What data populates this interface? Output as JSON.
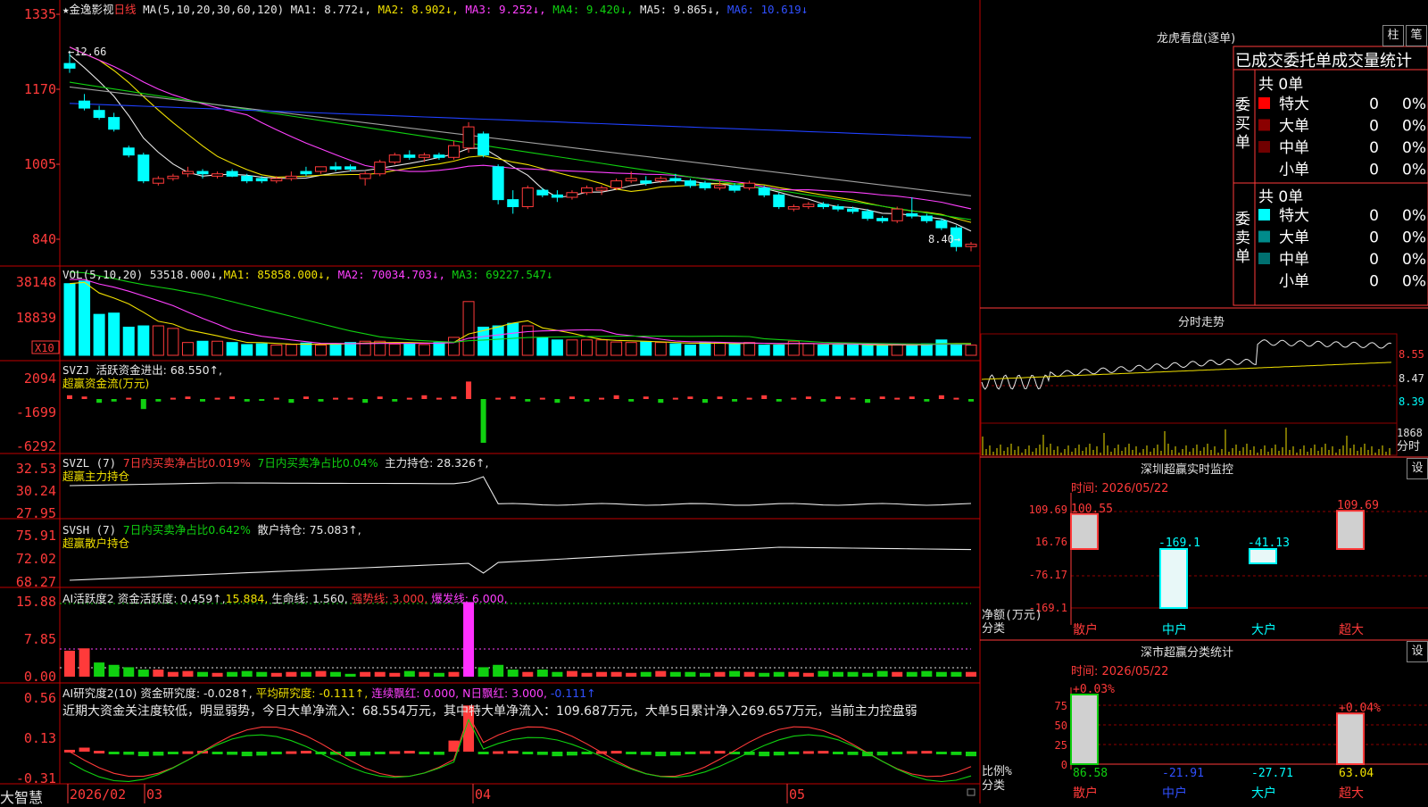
{
  "header": {
    "star": "★",
    "stock_name": "金逸影视",
    "period": "日线",
    "ma_label": "MA(5,10,20,30,60,120)",
    "ma1": "MA1: 8.772↓,",
    "ma2": "MA2: 8.902↓,",
    "ma3": "MA3: 9.252↓,",
    "ma4": "MA4: 9.420↓,",
    "ma5": "MA5: 9.865↓,",
    "ma6": "MA6: 10.619↓"
  },
  "price_axis": {
    "ticks": [
      "1335",
      "1170",
      "1005",
      "840"
    ],
    "high_mark": "12.66",
    "low_mark": "8.40"
  },
  "vol_panel": {
    "title": "VOL(5,10,20)",
    "vol": "53518.000↓,",
    "ma1": "MA1: 85858.000↓,",
    "ma2": "MA2: 70034.703↓,",
    "ma3": "MA3: 69227.547↓",
    "ticks": [
      "38148",
      "18839"
    ],
    "unit": "X10"
  },
  "svzj_panel": {
    "title": "SVZJ",
    "label": "活跃资金进出: 68.550↑,",
    "subtitle": "超赢资金流(万元)",
    "ticks": [
      "2094",
      "-1699",
      "-6292"
    ]
  },
  "svzl_panel": {
    "title": "SVZL (7)",
    "a": "7日内买卖净占比0.019%",
    "b": "7日内买卖净占比0.04%",
    "c": "主力持仓: 28.326↑,",
    "subtitle": "超赢主力持仓",
    "ticks": [
      "32.53",
      "30.24",
      "27.95"
    ]
  },
  "svsh_panel": {
    "title": "SVSH (7)",
    "a": "7日内买卖净占比0.642%",
    "c": "散户持仓: 75.083↑,",
    "subtitle": "超赢散户持仓",
    "ticks": [
      "75.91",
      "72.02",
      "68.27"
    ]
  },
  "ai_active_panel": {
    "title": "AI活跃度2",
    "a": "资金活跃度: 0.459↑,",
    "b": "15.884,",
    "c": "生命线: 1.560,",
    "d": "强势线: 3.000,",
    "e": "爆发线: 6.000,",
    "ticks": [
      "15.88",
      "7.85",
      "0.00"
    ]
  },
  "ai_research_panel": {
    "title": "AI研究度2(10)",
    "a": "资金研究度: -0.028↑,",
    "b": "平均研究度: -0.111↑,",
    "c": "连续飘红: 0.000,",
    "d": "N日飘红: 3.000,",
    "e": "-0.111↑",
    "comment": "近期大资金关注度较低，明显弱势，今日大单净流入：68.554万元，其中特大单净流入：109.687万元，大单5日累计净入269.657万元，当前主力控盘弱",
    "ticks": [
      "0.56",
      "0.13",
      "-0.31"
    ]
  },
  "footer": {
    "brand": "大智慧",
    "date_labels": [
      "2026/02",
      "03",
      "04",
      "05"
    ]
  },
  "right_panel": {
    "title": "龙虎看盘(逐单)",
    "btn_zhu": "柱",
    "btn_bi": "笔",
    "table_title": "已成交委托单成交量统计",
    "buy_header": "共 0单",
    "sell_header": "共 0单",
    "buy_side": "委买单",
    "sell_side": "委卖单",
    "buy_rows": [
      {
        "label": "特大",
        "count": "0",
        "pct": "0%",
        "color": "#ff0000"
      },
      {
        "label": "大单",
        "count": "0",
        "pct": "0%",
        "color": "#8b0000"
      },
      {
        "label": "中单",
        "count": "0",
        "pct": "0%",
        "color": "#700000"
      },
      {
        "label": "小单",
        "count": "0",
        "pct": "0%",
        "color": ""
      }
    ],
    "sell_rows": [
      {
        "label": "特大",
        "count": "0",
        "pct": "0%",
        "color": "#00ffff"
      },
      {
        "label": "大单",
        "count": "0",
        "pct": "0%",
        "color": "#008b8b"
      },
      {
        "label": "中单",
        "count": "0",
        "pct": "0%",
        "color": "#007070"
      },
      {
        "label": "小单",
        "count": "0",
        "pct": "0%",
        "color": ""
      }
    ],
    "intraday_title": "分时走势",
    "intraday_ticks": [
      "8.55",
      "8.47",
      "8.39"
    ],
    "intraday_vol": [
      "1868",
      "分时"
    ],
    "monitor_title": "深圳超赢实时监控",
    "monitor_btn": "设",
    "monitor_time": "时间: 2026/05/22",
    "monitor_ticks": [
      "109.69",
      "16.76",
      "-76.17",
      "-169.1"
    ],
    "monitor_ylabel": [
      "净额(万元)",
      "分类"
    ],
    "monitor_values": [
      "100.55",
      "-169.1",
      "-41.13",
      "109.69"
    ],
    "monitor_categories": [
      "散户",
      "中户",
      "大户",
      "超大"
    ],
    "class_title": "深市超赢分类统计",
    "class_btn": "设",
    "class_time": "时间: 2026/05/22",
    "class_ticks": [
      "75",
      "50",
      "25",
      "0"
    ],
    "class_top": [
      "+0.03%",
      "+0.04%"
    ],
    "class_ylabel": [
      "比例%",
      "分类"
    ],
    "class_values": [
      "86.58",
      "-21.91",
      "-27.71",
      "63.04"
    ],
    "class_categories": [
      "散户",
      "中户",
      "大户",
      "超大"
    ]
  },
  "chart_data": {
    "type": "candlestick",
    "title": "金逸影视 日线",
    "x_labels": [
      "2026/02",
      "03",
      "04",
      "05"
    ],
    "ohlc": [
      [
        12.4,
        12.66,
        12.2,
        12.3
      ],
      [
        11.6,
        11.75,
        11.4,
        11.45
      ],
      [
        11.4,
        11.5,
        11.2,
        11.25
      ],
      [
        11.25,
        11.35,
        10.95,
        11.0
      ],
      [
        10.6,
        10.65,
        10.4,
        10.45
      ],
      [
        10.45,
        10.5,
        9.85,
        9.9
      ],
      [
        9.85,
        10.0,
        9.8,
        9.95
      ],
      [
        9.95,
        10.05,
        9.9,
        10.0
      ],
      [
        10.05,
        10.2,
        9.98,
        10.1
      ],
      [
        10.1,
        10.15,
        9.95,
        10.05
      ],
      [
        10.0,
        10.1,
        9.95,
        10.05
      ],
      [
        10.1,
        10.15,
        9.98,
        10.0
      ],
      [
        10.0,
        10.05,
        9.85,
        9.9
      ],
      [
        9.95,
        10.0,
        9.85,
        9.9
      ],
      [
        9.9,
        10.0,
        9.85,
        9.95
      ],
      [
        9.95,
        10.1,
        9.9,
        10.0
      ],
      [
        10.1,
        10.2,
        10.0,
        10.05
      ],
      [
        10.1,
        10.2,
        10.05,
        10.2
      ],
      [
        10.2,
        10.3,
        10.1,
        10.15
      ],
      [
        10.2,
        10.25,
        10.1,
        10.15
      ],
      [
        9.95,
        10.1,
        9.8,
        10.05
      ],
      [
        10.05,
        10.35,
        10.0,
        10.3
      ],
      [
        10.3,
        10.5,
        10.25,
        10.45
      ],
      [
        10.45,
        10.55,
        10.35,
        10.4
      ],
      [
        10.4,
        10.5,
        10.3,
        10.45
      ],
      [
        10.45,
        10.5,
        10.35,
        10.4
      ],
      [
        10.4,
        10.75,
        10.35,
        10.65
      ],
      [
        10.6,
        11.15,
        10.5,
        11.05
      ],
      [
        10.9,
        10.95,
        10.4,
        10.45
      ],
      [
        10.2,
        10.25,
        9.4,
        9.5
      ],
      [
        9.5,
        9.7,
        9.2,
        9.35
      ],
      [
        9.35,
        9.8,
        9.3,
        9.75
      ],
      [
        9.7,
        9.75,
        9.55,
        9.6
      ],
      [
        9.6,
        9.7,
        9.45,
        9.55
      ],
      [
        9.55,
        9.7,
        9.5,
        9.65
      ],
      [
        9.65,
        9.8,
        9.6,
        9.75
      ],
      [
        9.7,
        9.8,
        9.6,
        9.75
      ],
      [
        9.75,
        9.95,
        9.7,
        9.9
      ],
      [
        9.9,
        10.1,
        9.85,
        9.95
      ],
      [
        9.9,
        10.0,
        9.8,
        9.85
      ],
      [
        9.9,
        10.0,
        9.85,
        9.95
      ],
      [
        9.95,
        10.05,
        9.85,
        9.9
      ],
      [
        9.9,
        9.95,
        9.75,
        9.8
      ],
      [
        9.85,
        9.9,
        9.7,
        9.75
      ],
      [
        9.75,
        9.9,
        9.7,
        9.8
      ],
      [
        9.8,
        9.85,
        9.65,
        9.7
      ],
      [
        9.75,
        9.9,
        9.7,
        9.85
      ],
      [
        9.75,
        9.8,
        9.55,
        9.6
      ],
      [
        9.6,
        9.65,
        9.3,
        9.35
      ],
      [
        9.3,
        9.4,
        9.25,
        9.35
      ],
      [
        9.35,
        9.45,
        9.3,
        9.4
      ],
      [
        9.4,
        9.45,
        9.3,
        9.35
      ],
      [
        9.35,
        9.4,
        9.25,
        9.3
      ],
      [
        9.3,
        9.35,
        9.2,
        9.25
      ],
      [
        9.25,
        9.3,
        9.05,
        9.1
      ],
      [
        9.1,
        9.15,
        9.0,
        9.05
      ],
      [
        9.05,
        9.35,
        9.0,
        9.3
      ],
      [
        9.2,
        9.55,
        9.1,
        9.15
      ],
      [
        9.15,
        9.2,
        9.0,
        9.05
      ],
      [
        9.05,
        9.1,
        8.85,
        8.9
      ],
      [
        8.9,
        8.95,
        8.4,
        8.5
      ],
      [
        8.5,
        8.6,
        8.4,
        8.55
      ]
    ],
    "volume": [
      28000,
      29000,
      16000,
      16500,
      11000,
      11500,
      11500,
      10500,
      5000,
      5500,
      5500,
      5000,
      4200,
      4500,
      4000,
      4200,
      4800,
      4000,
      4600,
      5000,
      5500,
      5500,
      4400,
      4500,
      4200,
      5000,
      7000,
      21000,
      11000,
      11500,
      12500,
      11500,
      7000,
      6000,
      6000,
      6000,
      6000,
      5200,
      5000,
      5200,
      5000,
      4500,
      4000,
      5000,
      5000,
      4400,
      5000,
      4000,
      4000,
      5500,
      4600,
      4000,
      4000,
      4000,
      4000,
      4000,
      4000,
      4000,
      4500,
      6000,
      4500,
      4000
    ]
  }
}
